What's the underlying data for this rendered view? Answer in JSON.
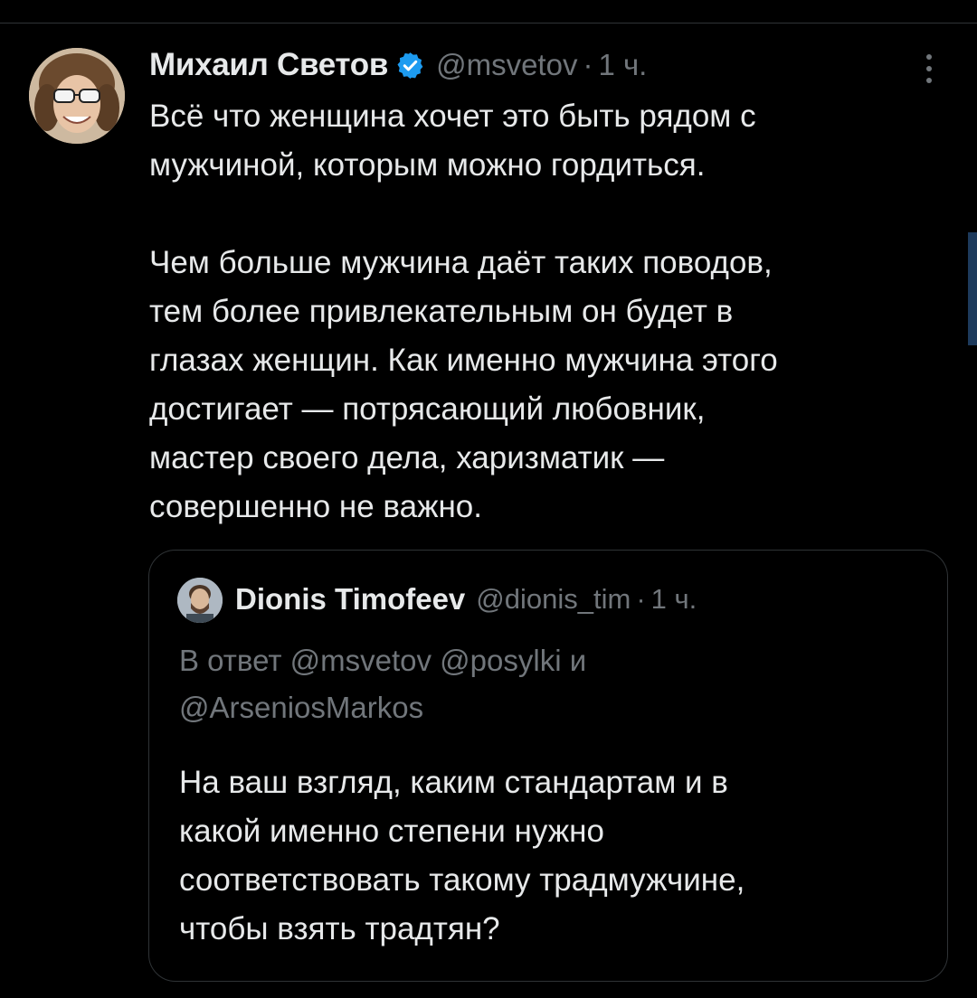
{
  "tweet": {
    "author_name": "Михаил Светов",
    "handle": "@msvetov",
    "separator": "·",
    "time": "1 ч.",
    "text_lines_1": [
      "Всё что женщина хочет это быть рядом с",
      "мужчиной, которым можно гордиться."
    ],
    "text_lines_2": [
      "Чем больше мужчина даёт таких поводов,",
      "тем более привлекательным он будет в",
      "глазах женщин. Как именно мужчина этого",
      "достигает — потрясающий любовник,",
      "мастер своего дела, харизматик —",
      "совершенно не важно."
    ],
    "verified_icon": "verified-badge-icon",
    "more_icon": "more-vertical-icon"
  },
  "quoted_tweet": {
    "author_name": "Dionis Timofeev",
    "handle": "@dionis_tim",
    "separator": "·",
    "time": "1 ч.",
    "reply_lines": [
      "В ответ @msvetov @posylki и",
      "@ArseniosMarkos"
    ],
    "text_lines": [
      "На ваш взгляд, каким стандартам и в",
      "какой именно степени нужно",
      "соответствовать такому традмужчине,",
      "чтобы взять традтян?"
    ]
  },
  "colors": {
    "background": "#000000",
    "text_primary": "#e7e9ea",
    "text_secondary": "#71767b",
    "border": "#2f3336",
    "verified": "#1d9bf0"
  }
}
